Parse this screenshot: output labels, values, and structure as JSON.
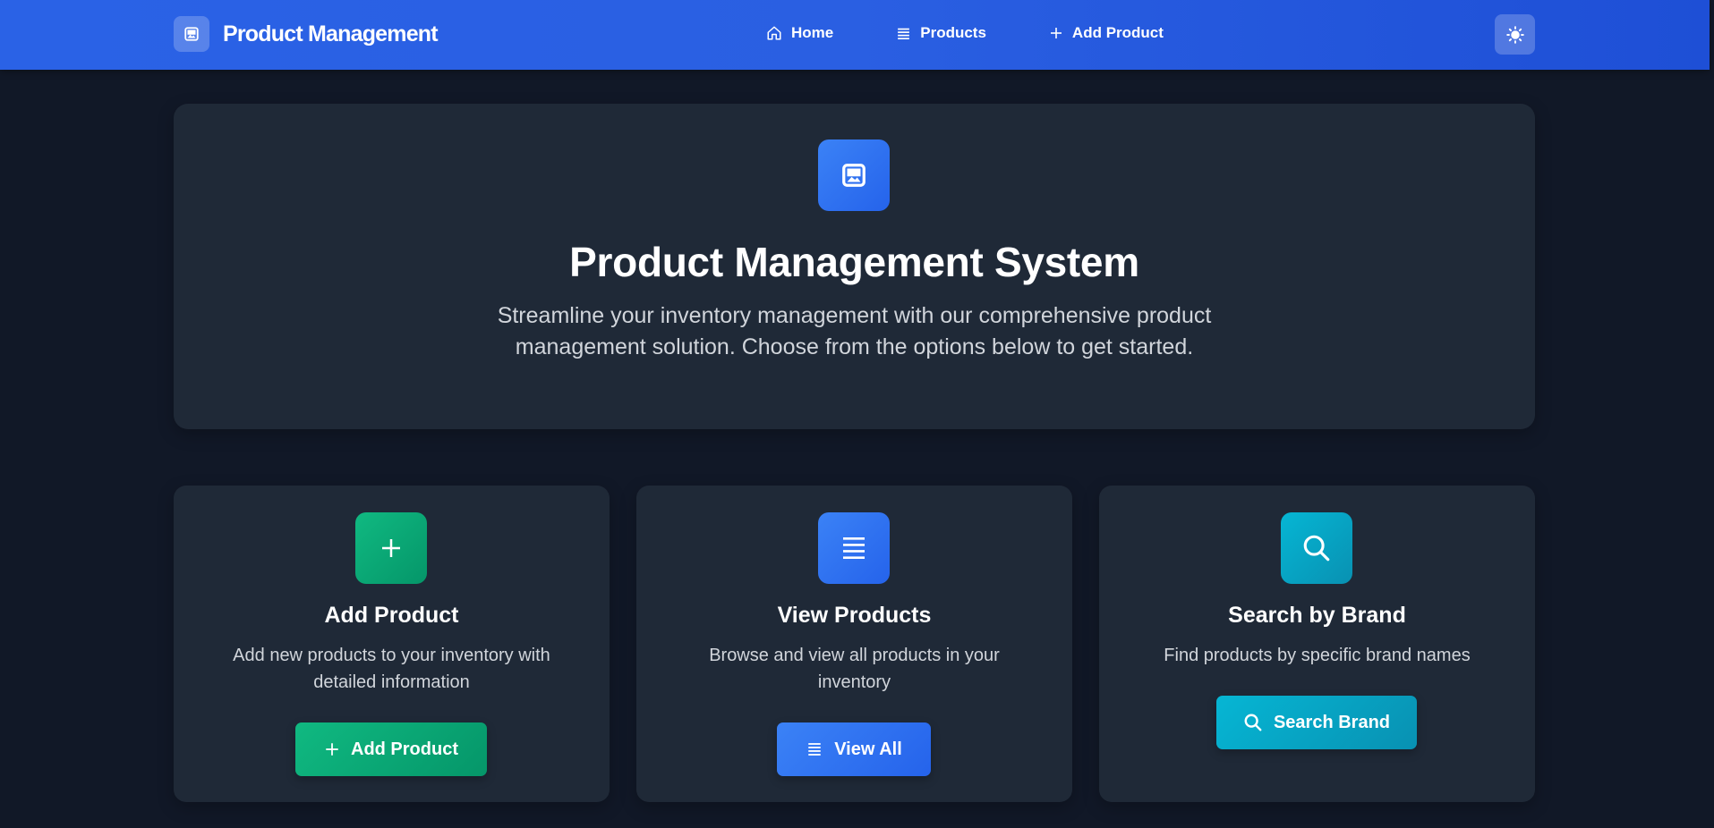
{
  "navbar": {
    "brand_title": "Product Management",
    "links": [
      {
        "label": "Home",
        "icon": "home-icon"
      },
      {
        "label": "Products",
        "icon": "list-icon"
      },
      {
        "label": "Add Product",
        "icon": "plus-icon"
      }
    ],
    "theme_toggle_icon": "sun-icon"
  },
  "hero": {
    "icon": "image-icon",
    "title": "Product Management System",
    "description": "Streamline your inventory management with our comprehensive product management solution. Choose from the options below to get started."
  },
  "cards": [
    {
      "icon": "plus-icon",
      "title": "Add Product",
      "description": "Add new products to your inventory with detailed information",
      "button_label": "Add Product",
      "accent": "#10b981"
    },
    {
      "icon": "list-icon",
      "title": "View Products",
      "description": "Browse and view all products in your inventory",
      "button_label": "View All",
      "accent": "#3b82f6"
    },
    {
      "icon": "search-icon",
      "title": "Search by Brand",
      "description": "Find products by specific brand names",
      "button_label": "Search Brand",
      "accent": "#06b6d4"
    }
  ],
  "colors": {
    "background": "#111827",
    "card": "#1f2937",
    "navbar": "#2563eb"
  }
}
